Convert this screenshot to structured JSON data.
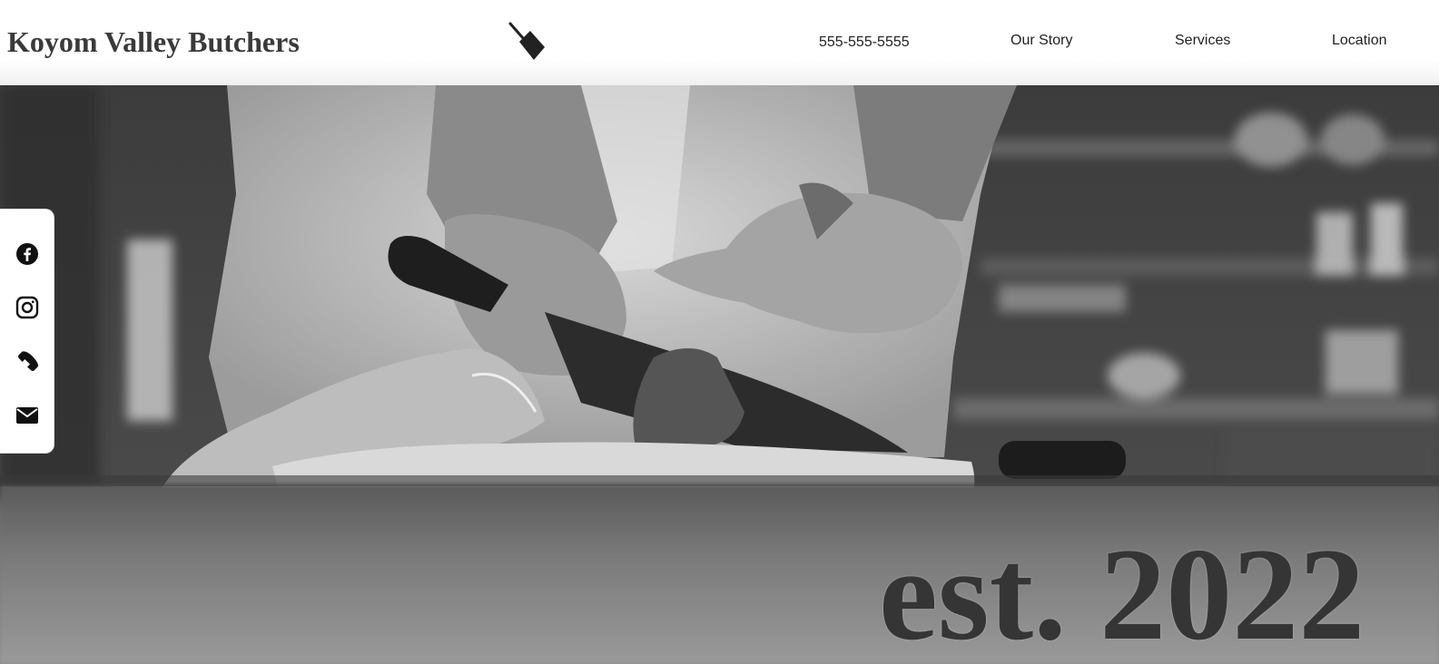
{
  "header": {
    "brand": "Koyom Valley Butchers",
    "logo_icon": "cleaver-icon"
  },
  "nav": {
    "phone": "555-555-5555",
    "items": [
      "Our Story",
      "Services",
      "Location"
    ]
  },
  "hero": {
    "title": "est. 2022",
    "image": "black-and-white photo of butcher hands cutting meat with a knife"
  },
  "social": {
    "icons": [
      "facebook-icon",
      "instagram-icon",
      "phone-icon",
      "email-icon"
    ]
  },
  "colors": {
    "brand_text": "#3a3a3a",
    "hero_text": "#353535",
    "rail_background": "#ffffff"
  }
}
